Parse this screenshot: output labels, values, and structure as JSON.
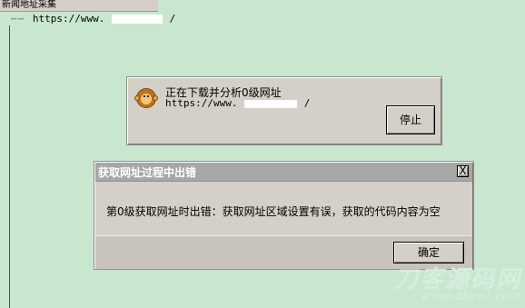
{
  "page": {
    "top_label": "新闻地址采集",
    "tree_url_prefix": "https://www.",
    "tree_url_suffix": "/"
  },
  "download_dialog": {
    "title": "正在下载并分析0级网址",
    "url_prefix": "https://www.",
    "url_suffix": "/",
    "stop_button": "停止",
    "icon": "monkey-icon"
  },
  "error_dialog": {
    "title": "获取网址过程中出错",
    "close_symbol": "X",
    "message": "第0级获取网址时出错：获取网址区域设置有误，获取的代码内容为空",
    "ok_button": "确定"
  },
  "watermark": {
    "main": "刀客源码网",
    "sub": "www.dkewl.com"
  },
  "colors": {
    "background": "#c9e7cf",
    "dialog": "#d4d0c8",
    "error_titlebar": "#a7a7a7"
  }
}
